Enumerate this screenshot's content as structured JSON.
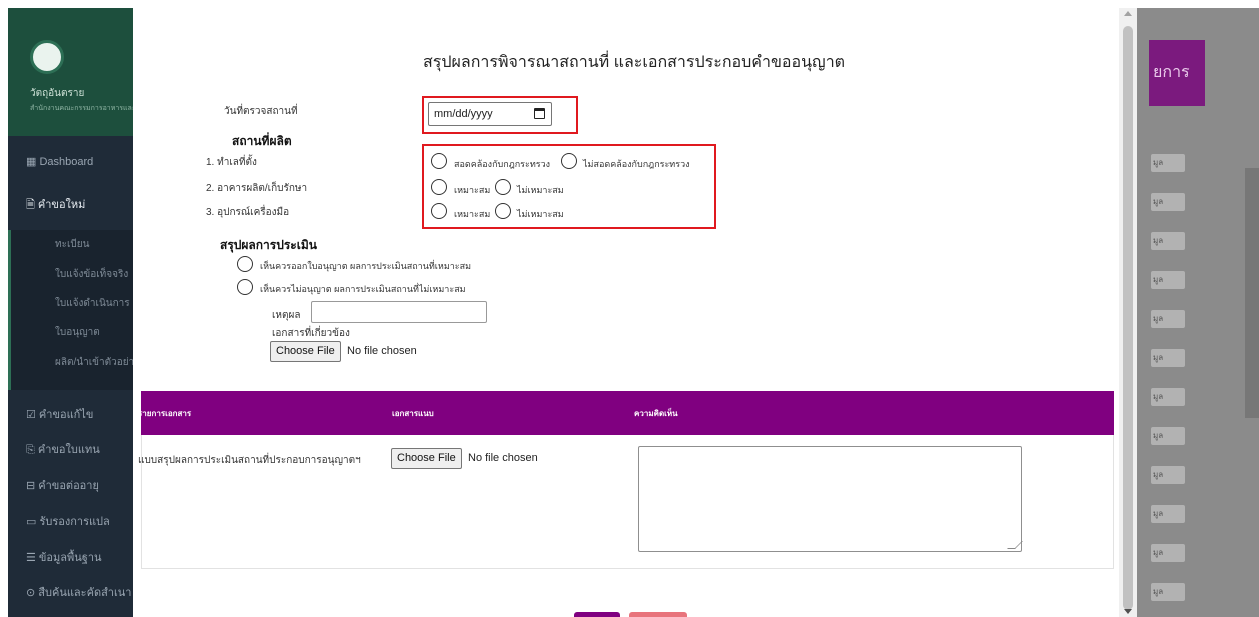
{
  "sidebar": {
    "brand_name": "วัตถุอันตราย",
    "brand_sub": "สำนักงานคณะกรรมการอาหารและยา",
    "items": [
      {
        "label": "▦ Dashboard"
      },
      {
        "label": "🗎 คำขอใหม่"
      },
      {
        "label": "☑ คำขอแก้ไข"
      },
      {
        "label": "⎘ คำขอใบแทน"
      },
      {
        "label": "⊟ คำขอต่ออายุ"
      },
      {
        "label": "▭ รับรองการแปล"
      },
      {
        "label": "☰ ข้อมูลพื้นฐาน"
      },
      {
        "label": "⊙ สืบค้นและคัดสำเนา"
      }
    ],
    "submenu": [
      {
        "label": "ทะเบียน"
      },
      {
        "label": "ใบแจ้งข้อเท็จจริง"
      },
      {
        "label": "ใบแจ้งดำเนินการ"
      },
      {
        "label": "ใบอนุญาต"
      },
      {
        "label": "ผลิต/นำเข้าตัวอย่าง"
      }
    ]
  },
  "background_right": {
    "button_label": "ยการ",
    "mini_label": "มูล"
  },
  "modal": {
    "title": "สรุปผลการพิจารณาสถานที่ และเอกสารประกอบคำขออนุญาต",
    "inspection_date_label": "วันที่ตรวจสถานที่",
    "date_placeholder": "mm/dd/yyyy",
    "production_heading": "สถานที่ผลิต",
    "criteria": [
      {
        "label": "1. ทำเลที่ตั้ง",
        "option_yes": "สอดคล้องกับกฎกระทรวง",
        "option_no": "ไม่สอดคล้องกับกฎกระทรวง"
      },
      {
        "label": "2. อาคารผลิต/เก็บรักษา",
        "option_yes": "เหมาะสม",
        "option_no": "ไม่เหมาะสม"
      },
      {
        "label": "3. อุปกรณ์เครื่องมือ",
        "option_yes": "เหมาะสม",
        "option_no": "ไม่เหมาะสม"
      }
    ],
    "summary_heading": "สรุปผลการประเมิน",
    "summary_options": [
      "เห็นควรออกใบอนุญาต ผลการประเมินสถานที่เหมาะสม",
      "เห็นควรไม่อนุญาต ผลการประเมินสถานที่ไม่เหมาะสม"
    ],
    "reason_label": "เหตุผล",
    "related_docs_label": "เอกสารที่เกี่ยวข้อง",
    "file_button": "Choose File",
    "file_status": "No file chosen",
    "table": {
      "headers": [
        "รายการเอกสาร",
        "เอกสารแนบ",
        "ความคิดเห็น"
      ],
      "rows": [
        {
          "document": "แบบสรุปผลการประเมินสถานที่ประกอบการอนุญาตฯ",
          "file_button": "Choose File",
          "file_status": "No file chosen",
          "comment": ""
        }
      ]
    }
  },
  "colors": {
    "accent": "#800080",
    "highlight": "#e0191f",
    "sidebar": "#1f2b38"
  }
}
